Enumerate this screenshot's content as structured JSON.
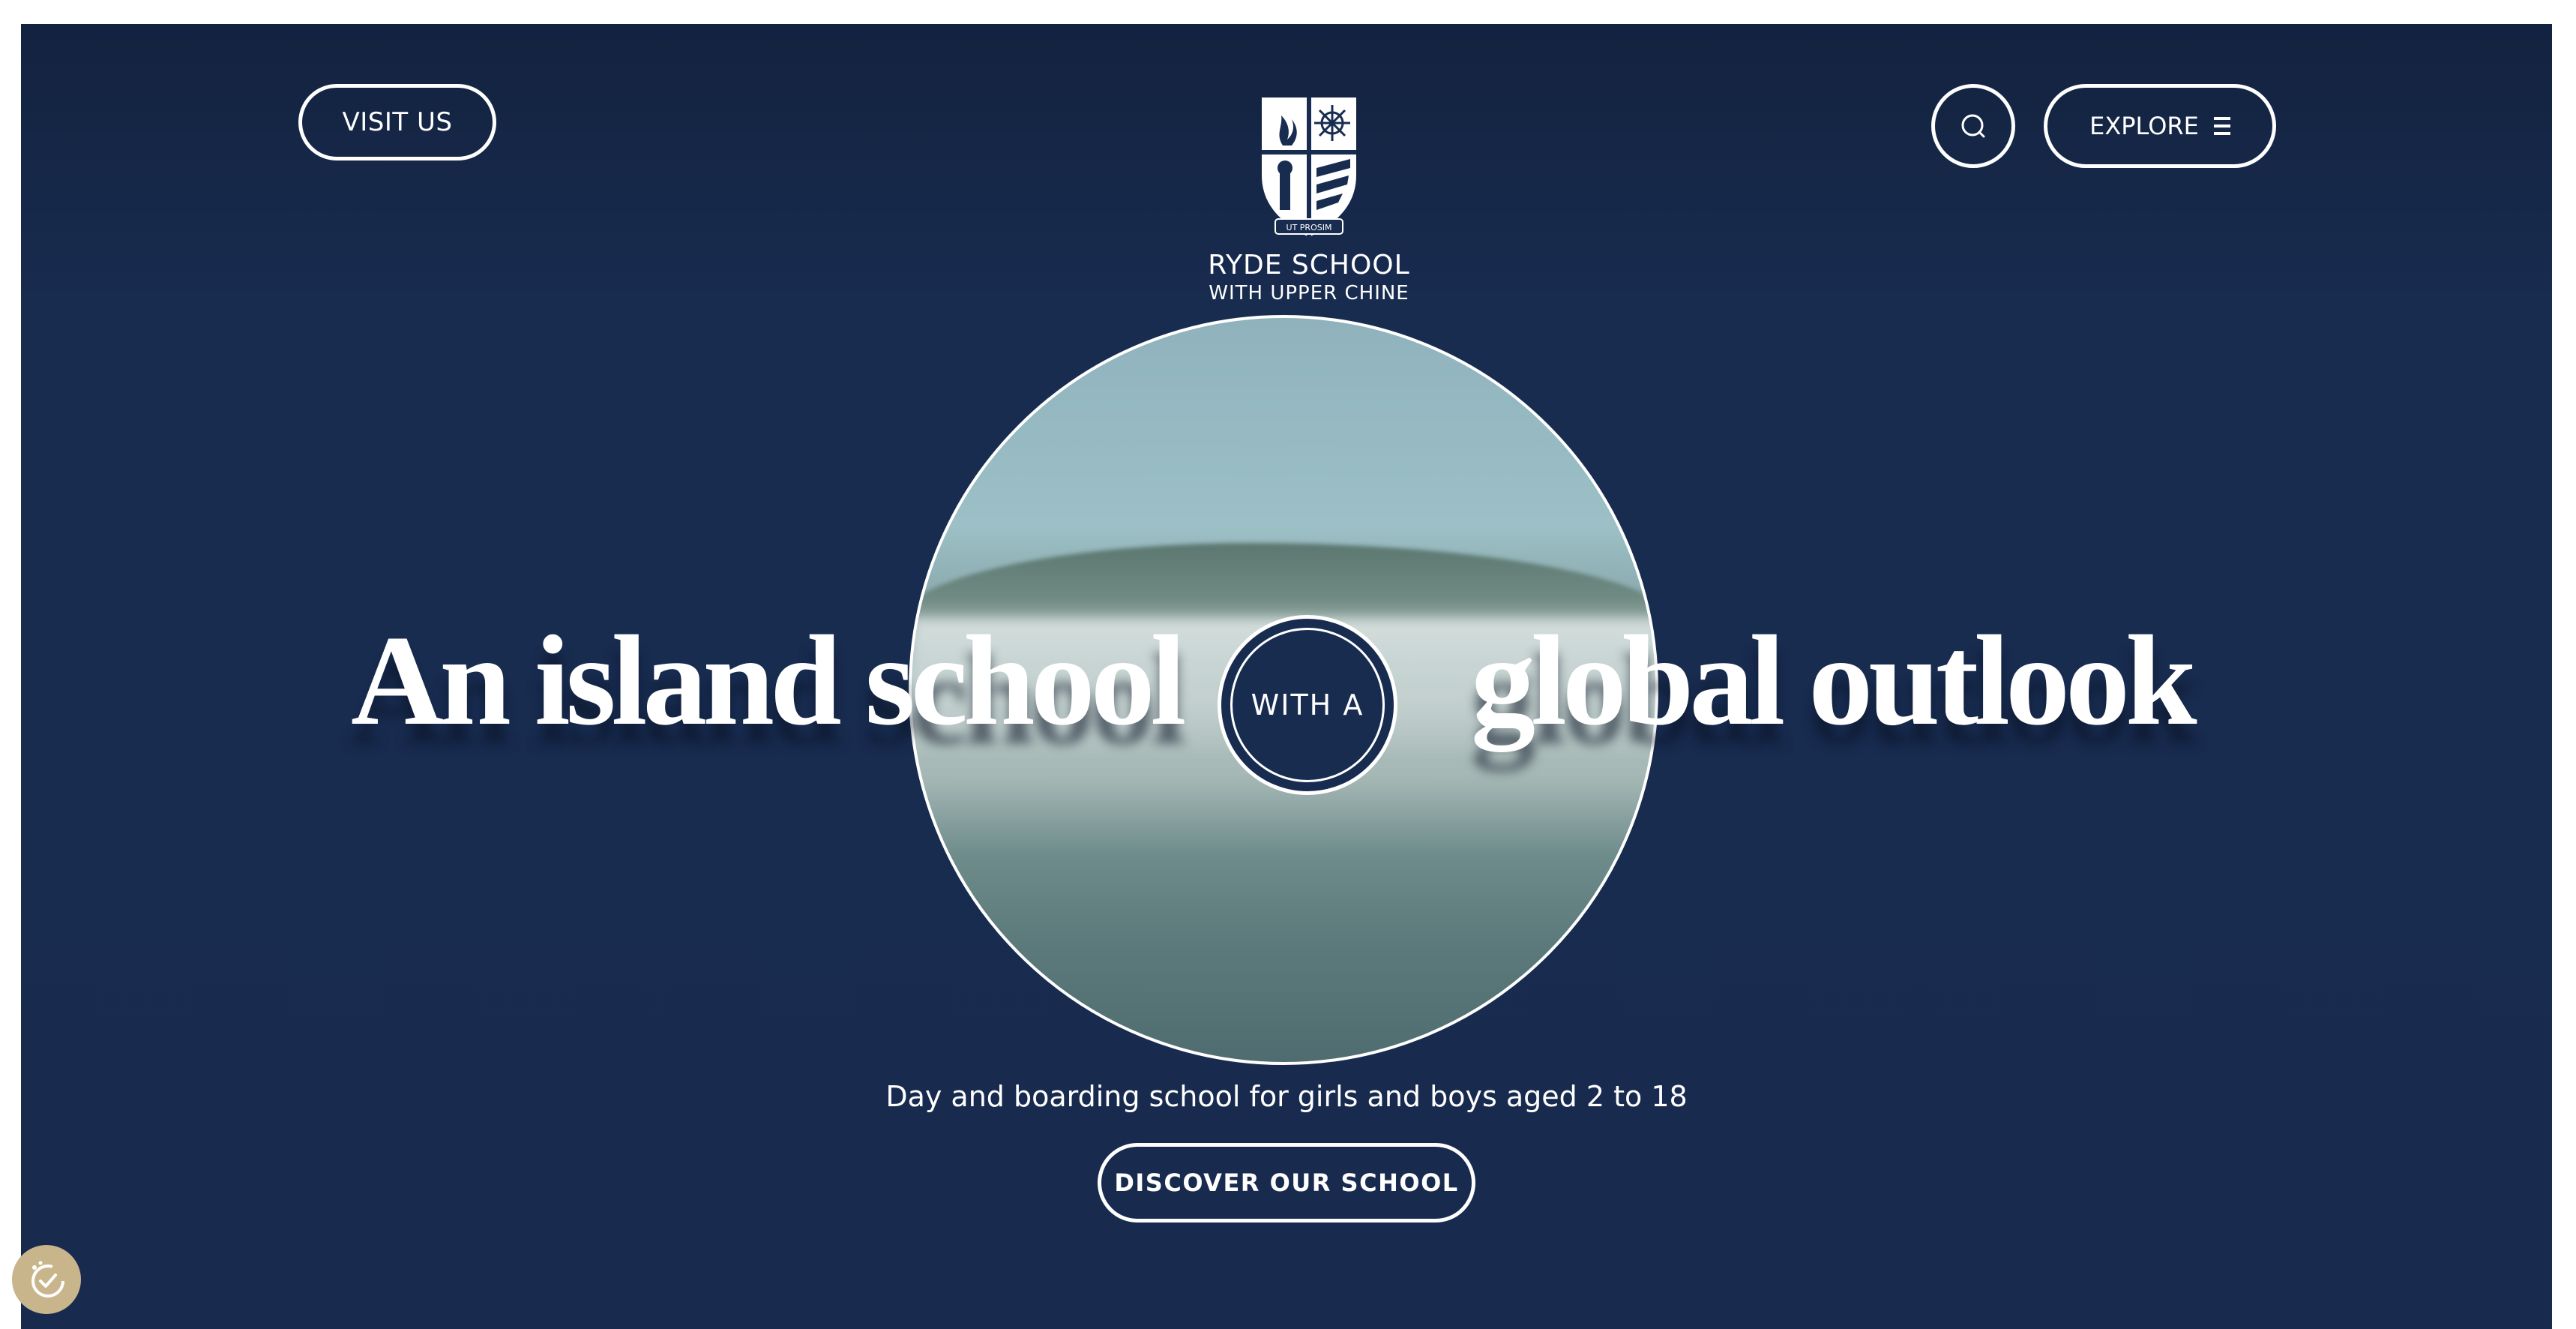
{
  "header": {
    "visit_label": "VISIT US",
    "explore_label": "EXPLORE",
    "logo_name": "RYDE SCHOOL",
    "logo_sub": "WITH UPPER CHINE",
    "logo_motto": "UT PROSIM"
  },
  "hero": {
    "headline_left": "An island school",
    "connector": "WITH A",
    "headline_right": "global outlook",
    "tagline": "Day and boarding school for girls and boys aged 2 to 18",
    "cta_label": "DISCOVER OUR SCHOOL"
  },
  "icons": {
    "search": "search-icon",
    "menu": "hamburger-icon",
    "logo": "school-crest-icon",
    "accessibility": "accessibility-check-icon"
  },
  "colors": {
    "background": "#182c50",
    "header_dark": "#13223f",
    "text": "#ffffff",
    "accessibility_badge": "#c9b58b"
  }
}
